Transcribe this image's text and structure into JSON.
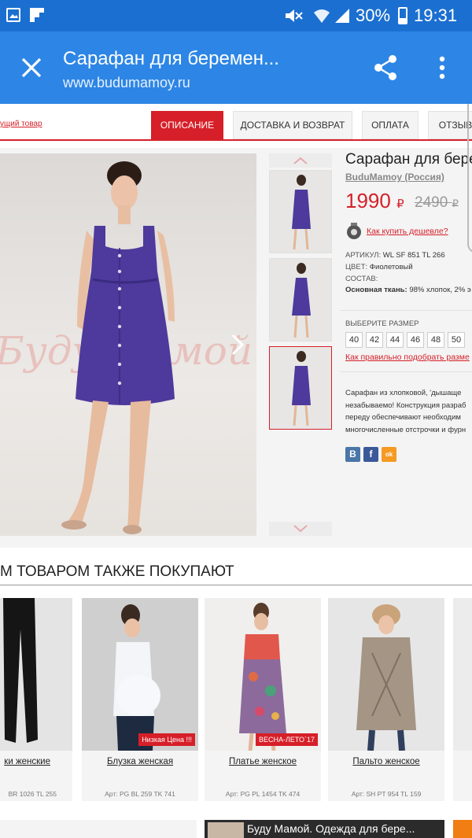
{
  "status_bar": {
    "battery": "30%",
    "time": "19:31"
  },
  "app_bar": {
    "title": "Сарафан для беремен...",
    "url": "www.budumamoy.ru"
  },
  "nav": {
    "back_link": "ущий товар"
  },
  "tabs": [
    {
      "label": "ОПИСАНИЕ"
    },
    {
      "label": "ДОСТАВКА И ВОЗВРАТ"
    },
    {
      "label": "ОПЛАТА"
    },
    {
      "label": "ОТЗЫВ"
    }
  ],
  "gallery": {
    "watermark": "Буду Мамой"
  },
  "product": {
    "title": "Сарафан для бере",
    "brand": "BuduMamoy (Россия)",
    "price": "1990",
    "currency": "₽",
    "old_price": "2490",
    "cheaper_link": "Как купить дешевле?",
    "specs": [
      {
        "label": "АРТИКУЛ:",
        "value": "WL SF 851 TL 266"
      },
      {
        "label": "ЦВЕТ:",
        "value": "Фиолетовый"
      },
      {
        "label": "СОСТАВ:",
        "value": ""
      },
      {
        "label": "Основная ткань:",
        "value": "98% хлопок, 2% э"
      }
    ],
    "size_label": "ВЫБЕРИТЕ РАЗМЕР",
    "sizes": [
      "40",
      "42",
      "44",
      "46",
      "48",
      "50"
    ],
    "size_guide_link": "Как правильно подобрать разме",
    "description": [
      "Сарафан из хлопковой, 'дышаще",
      "незабываемо! Конструкция разраб",
      "переду обеспечивают необходим",
      "многочисленные отстрочки и фурн"
    ],
    "social": [
      "В",
      "f",
      "ok"
    ]
  },
  "recommendations": {
    "heading": "М ТОВАРОМ ТАКЖЕ ПОКУПАЮТ",
    "items": [
      {
        "name": "ки женские",
        "article": "BR 1026 TL 255",
        "badge": ""
      },
      {
        "name": "Блузка женская",
        "article": "Арт: PG BL 259 TK 741",
        "badge": "Низкая Цена !!!"
      },
      {
        "name": "Платье женское",
        "article": "Арт: PG PL 1454 TK 474",
        "badge": "ВЕСНА-ЛЕТО`17"
      },
      {
        "name": "Пальто женское",
        "article": "Арт: SH PT 954 TL 159",
        "badge": ""
      }
    ]
  },
  "bottom_banner": {
    "text": "Буду Мамой. Одежда для бере..."
  },
  "colors": {
    "status_bar": "#1b6fd0",
    "app_bar": "#2d86e6",
    "accent_red": "#d61f28",
    "dress_purple": "#4d3a9c"
  }
}
